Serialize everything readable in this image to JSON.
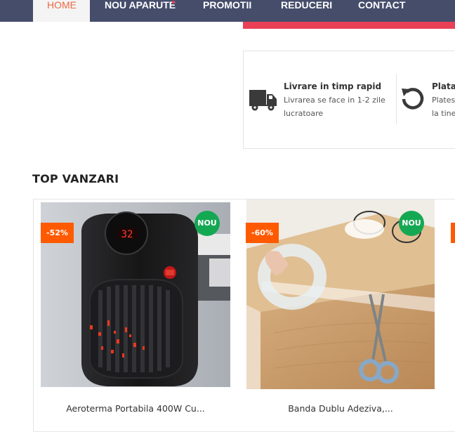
{
  "nav": {
    "items": [
      {
        "label": "HOME"
      },
      {
        "label": "NOU APARUTE"
      },
      {
        "label": "PROMOTII"
      },
      {
        "label": "REDUCERI"
      },
      {
        "label": "CONTACT"
      }
    ]
  },
  "features": [
    {
      "icon": "truck-icon",
      "title": "Livrare in timp rapid",
      "line1": "Livrarea se face in 1-2 zile",
      "line2": "lucratoare"
    },
    {
      "icon": "return-icon",
      "title": "Plata",
      "line1": "Plates",
      "line2": "la tine"
    }
  ],
  "section": {
    "title": "TOP VANZARI"
  },
  "products": [
    {
      "title": "Aeroterma Portabila 400W Cu...",
      "discount": "-52%",
      "badge": "NOU",
      "display": "32"
    },
    {
      "title": "Banda Dublu Adeziva,...",
      "discount": "-60%",
      "badge": "NOU"
    }
  ],
  "colors": {
    "nav_bg": "#454d6b",
    "accent": "#ee6a43",
    "discount": "#ff5a00",
    "new_badge": "#14a853",
    "pink": "#e94057"
  }
}
